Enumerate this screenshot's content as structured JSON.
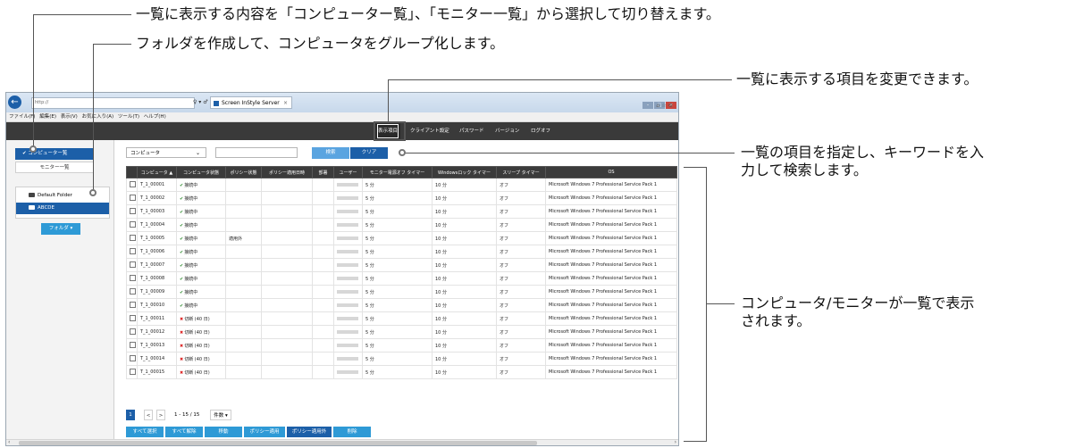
{
  "callouts": {
    "switch_list": "一覧に表示する内容を「コンピューター覧」、「モニター一覧」から選択して切り替えます。",
    "folder": "フォルダを作成して、コンピュータをグループ化します。",
    "display_items": "一覧に表示する項目を変更できます。",
    "search_line1": "一覧の項目を指定し、キーワードを入",
    "search_line2": "力して検索します。",
    "list_line1": "コンピュータ/モニターが一覧で表示",
    "list_line2": "されます。"
  },
  "browser": {
    "address": "http://",
    "address_controls": "♀ ▾ ♂",
    "tab_title": "Screen InStyle Server",
    "tab_close": "×",
    "menu": [
      "ファイル(F)",
      "編集(E)",
      "表示(V)",
      "お気に入り(A)",
      "ツール(T)",
      "ヘルプ(H)"
    ]
  },
  "nav": {
    "display_items": "表示項目",
    "client_settings": "クライアント設定",
    "password": "パスワード",
    "version": "バージョン",
    "logoff": "ログオフ"
  },
  "sidebar": {
    "computer_list": "✔ コンピューター覧",
    "monitor_list": "モニター一覧",
    "folders": [
      "Default Folder",
      "ABCDE"
    ],
    "folder_button": "フォルダ ▾"
  },
  "search": {
    "select_value": "コンピュータ",
    "search_button": "検索",
    "clear_button": "クリア"
  },
  "table": {
    "headers": [
      "",
      "コンピュータ ▲",
      "コンピュータ状態",
      "ポリシー状態",
      "ポリシー適用日時",
      "部署",
      "ユーザー",
      "モニター電源オフ タイマー",
      "Windowsロック タイマー",
      "スリープ タイマー",
      "OS"
    ],
    "rows": [
      {
        "name": "T_1_00001",
        "status": "接続中",
        "ok": true,
        "policy": "",
        "power": "5 分",
        "lock": "10 分",
        "sleep": "オフ",
        "os": "Microsoft Windows 7 Professional Service Pack 1"
      },
      {
        "name": "T_1_00002",
        "status": "接続中",
        "ok": true,
        "policy": "",
        "power": "5 分",
        "lock": "10 分",
        "sleep": "オフ",
        "os": "Microsoft Windows 7 Professional Service Pack 1"
      },
      {
        "name": "T_1_00003",
        "status": "接続中",
        "ok": true,
        "policy": "",
        "power": "5 分",
        "lock": "10 分",
        "sleep": "オフ",
        "os": "Microsoft Windows 7 Professional Service Pack 1"
      },
      {
        "name": "T_1_00004",
        "status": "接続中",
        "ok": true,
        "policy": "",
        "power": "5 分",
        "lock": "10 分",
        "sleep": "オフ",
        "os": "Microsoft Windows 7 Professional Service Pack 1"
      },
      {
        "name": "T_1_00005",
        "status": "接続中",
        "ok": true,
        "policy": "適用外",
        "power": "5 分",
        "lock": "10 分",
        "sleep": "オフ",
        "os": "Microsoft Windows 7 Professional Service Pack 1"
      },
      {
        "name": "T_1_00006",
        "status": "接続中",
        "ok": true,
        "policy": "",
        "power": "5 分",
        "lock": "10 分",
        "sleep": "オフ",
        "os": "Microsoft Windows 7 Professional Service Pack 1"
      },
      {
        "name": "T_1_00007",
        "status": "接続中",
        "ok": true,
        "policy": "",
        "power": "5 分",
        "lock": "10 分",
        "sleep": "オフ",
        "os": "Microsoft Windows 7 Professional Service Pack 1"
      },
      {
        "name": "T_1_00008",
        "status": "接続中",
        "ok": true,
        "policy": "",
        "power": "5 分",
        "lock": "10 分",
        "sleep": "オフ",
        "os": "Microsoft Windows 7 Professional Service Pack 1"
      },
      {
        "name": "T_1_00009",
        "status": "接続中",
        "ok": true,
        "policy": "",
        "power": "5 分",
        "lock": "10 分",
        "sleep": "オフ",
        "os": "Microsoft Windows 7 Professional Service Pack 1"
      },
      {
        "name": "T_1_00010",
        "status": "接続中",
        "ok": true,
        "policy": "",
        "power": "5 分",
        "lock": "10 分",
        "sleep": "オフ",
        "os": "Microsoft Windows 7 Professional Service Pack 1"
      },
      {
        "name": "T_1_00011",
        "status": "切断 (40 日)",
        "ok": false,
        "policy": "",
        "power": "5 分",
        "lock": "10 分",
        "sleep": "オフ",
        "os": "Microsoft Windows 7 Professional Service Pack 1"
      },
      {
        "name": "T_1_00012",
        "status": "切断 (40 日)",
        "ok": false,
        "policy": "",
        "power": "5 分",
        "lock": "10 分",
        "sleep": "オフ",
        "os": "Microsoft Windows 7 Professional Service Pack 1"
      },
      {
        "name": "T_1_00013",
        "status": "切断 (40 日)",
        "ok": false,
        "policy": "",
        "power": "5 分",
        "lock": "10 分",
        "sleep": "オフ",
        "os": "Microsoft Windows 7 Professional Service Pack 1"
      },
      {
        "name": "T_1_00014",
        "status": "切断 (40 日)",
        "ok": false,
        "policy": "",
        "power": "5 分",
        "lock": "10 分",
        "sleep": "オフ",
        "os": "Microsoft Windows 7 Professional Service Pack 1"
      },
      {
        "name": "T_1_00015",
        "status": "切断 (40 日)",
        "ok": false,
        "policy": "",
        "power": "5 分",
        "lock": "10 分",
        "sleep": "オフ",
        "os": "Microsoft Windows 7 Professional Service Pack 1"
      }
    ]
  },
  "pager": {
    "current": "1",
    "prev": "<",
    "next": ">",
    "range": "1 - 15 / 15",
    "per_page": "件数 ▾"
  },
  "actions": [
    "すべて選択",
    "すべて解除",
    "移動",
    "ポリシー適用",
    "ポリシー適用外",
    "削除"
  ],
  "colors": {
    "accent": "#1c5fa8",
    "button": "#2e9ad6",
    "nav": "#3a3a3a"
  }
}
